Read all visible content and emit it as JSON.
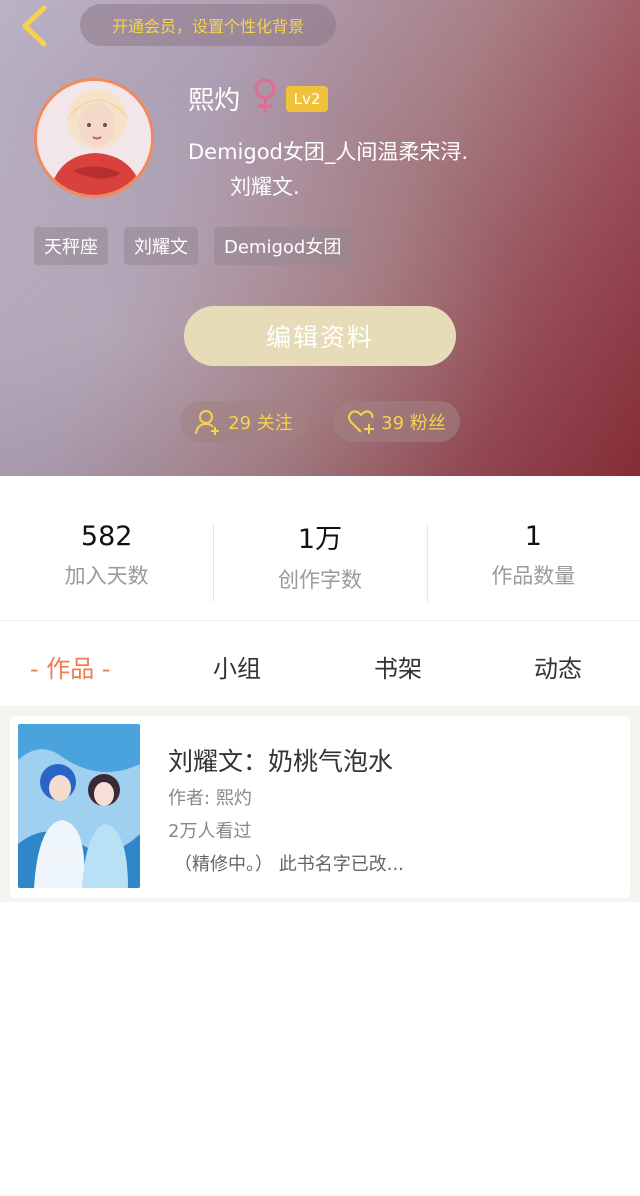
{
  "header": {
    "back_icon": "chevron-left-icon",
    "vip_banner": "开通会员，设置个性化背景"
  },
  "profile": {
    "nickname": "熙灼",
    "gender_icon": "female-icon",
    "level": "Lv2",
    "bio_line1": "Demigod女团_人间温柔宋浔.",
    "bio_line2": "刘耀文.",
    "tags": [
      "天秤座",
      "刘耀文",
      "Demigod女团"
    ],
    "edit_button": "编辑资料",
    "follow": {
      "icon": "user-plus-icon",
      "label": "29 关注"
    },
    "fans": {
      "icon": "heart-plus-icon",
      "label": "39 粉丝"
    }
  },
  "stats": [
    {
      "value": "582",
      "label": "加入天数"
    },
    {
      "value": "1万",
      "label": "创作字数"
    },
    {
      "value": "1",
      "label": "作品数量"
    }
  ],
  "tabs": {
    "works": "- 作品 -",
    "group": "小组",
    "bookshelf": "书架",
    "activity": "动态"
  },
  "works": [
    {
      "title": "刘耀文：奶桃气泡水",
      "author": "作者: 熙灼",
      "views": "2万人看过",
      "description": "（精修中。） 此书名字已改..."
    }
  ],
  "colors": {
    "accent": "#f07c4f",
    "gold": "#f7d34b",
    "edit_button": "#e7dcb8",
    "level_badge": "#f0c23a"
  }
}
